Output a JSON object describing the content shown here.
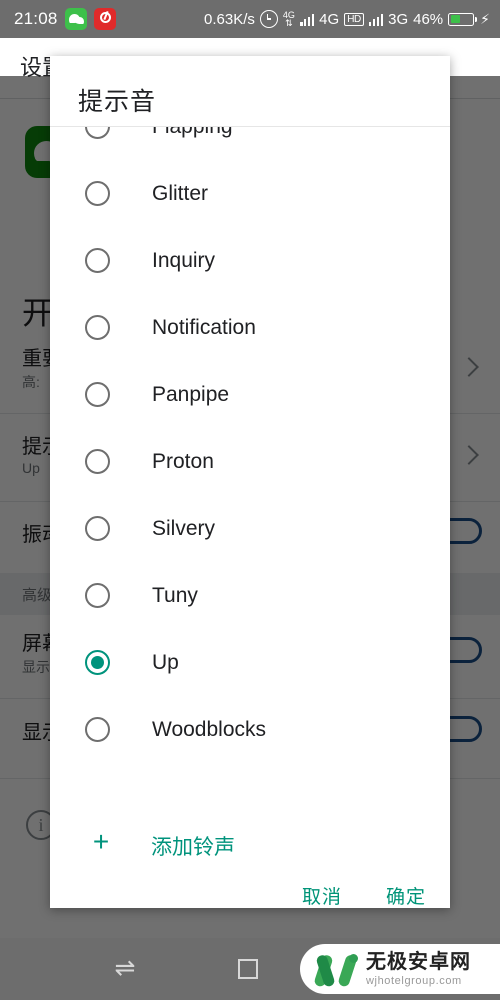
{
  "statusbar": {
    "clock": "21:08",
    "apps": [
      "wechat-icon",
      "netease-music-icon"
    ],
    "net_speed": "0.63K/s",
    "alarm_icon": "alarm-clock-icon",
    "data_icon": "4G",
    "network_1": "4G",
    "hd_badge": "HD",
    "network_2": "3G",
    "battery_percent": "46%",
    "charging_icon": "bolt-icon"
  },
  "background": {
    "title": "设置",
    "app_icon": "wechat-app-icon",
    "heading": "开",
    "rows": [
      {
        "title": "重要",
        "subtitle": "高:"
      },
      {
        "title": "提示",
        "subtitle": "Up"
      },
      {
        "title": "振动",
        "subtitle": ""
      }
    ],
    "section_label": "高级",
    "rows2": [
      {
        "title": "屏幕",
        "subtitle": "显示"
      },
      {
        "title": "显示",
        "subtitle": ""
      }
    ],
    "info_icon": "info-icon"
  },
  "dialog": {
    "title": "提示音",
    "options": [
      {
        "label": "Flapping",
        "selected": false
      },
      {
        "label": "Glitter",
        "selected": false
      },
      {
        "label": "Inquiry",
        "selected": false
      },
      {
        "label": "Notification",
        "selected": false
      },
      {
        "label": "Panpipe",
        "selected": false
      },
      {
        "label": "Proton",
        "selected": false
      },
      {
        "label": "Silvery",
        "selected": false
      },
      {
        "label": "Tuny",
        "selected": false
      },
      {
        "label": "Up",
        "selected": true
      },
      {
        "label": "Woodblocks",
        "selected": false
      }
    ],
    "add_ringtone": {
      "icon": "plus-icon",
      "label": "添加铃声"
    },
    "cancel_label": "取消",
    "confirm_label": "确定",
    "accent_color": "#00937c"
  },
  "navbar": {
    "recent_icon": "swap-arrows-icon",
    "home_icon": "square-icon"
  },
  "watermark": {
    "logo": "w-logo-icon",
    "name_cn": "无极安卓网",
    "name_en": "wjhotelgroup.com"
  }
}
